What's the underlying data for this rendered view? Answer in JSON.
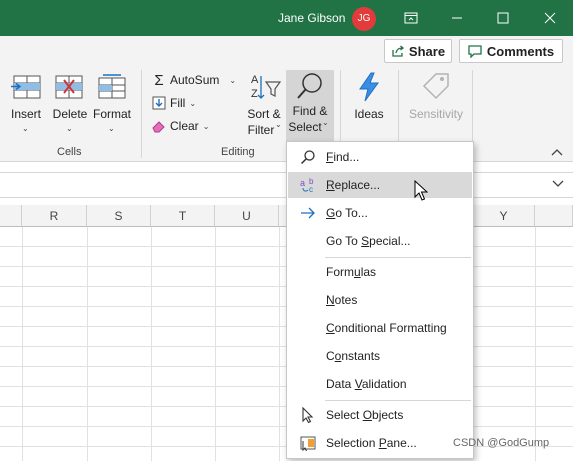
{
  "titlebar": {
    "user_name": "Jane Gibson",
    "avatar_initials": "JG",
    "bg_color": "#217346",
    "avatar_color": "#e23b3b"
  },
  "header_buttons": {
    "share": "Share",
    "comments": "Comments"
  },
  "ribbon": {
    "cells_group": {
      "label": "Cells",
      "insert": "Insert",
      "delete": "Delete",
      "format": "Format"
    },
    "editing_group": {
      "label": "Editing",
      "autosum": "AutoSum",
      "fill": "Fill",
      "clear": "Clear",
      "sort_filter_line1": "Sort &",
      "sort_filter_line2": "Filter",
      "find_select_line1": "Find &",
      "find_select_line2": "Select"
    },
    "ideas_group": {
      "ideas": "Ideas"
    },
    "sensitivity": "Sensitivity"
  },
  "columns": [
    "R",
    "S",
    "T",
    "U",
    "Y"
  ],
  "menu": {
    "items_group1": [
      {
        "key": "find",
        "pre": "",
        "u": "F",
        "post": "ind...",
        "icon": "search-icon"
      },
      {
        "key": "replace",
        "pre": "",
        "u": "R",
        "post": "eplace...",
        "icon": "replace-icon"
      },
      {
        "key": "goto",
        "pre": "",
        "u": "G",
        "post": "o To...",
        "icon": "arrow-right-icon"
      },
      {
        "key": "goto_special",
        "pre": "Go To ",
        "u": "S",
        "post": "pecial...",
        "icon": ""
      }
    ],
    "items_group2": [
      {
        "key": "formulas",
        "pre": "Form",
        "u": "u",
        "post": "las"
      },
      {
        "key": "notes",
        "pre": "",
        "u": "N",
        "post": "otes"
      },
      {
        "key": "conditional_formatting",
        "pre": "",
        "u": "C",
        "post": "onditional Formatting"
      },
      {
        "key": "constants",
        "pre": "C",
        "u": "o",
        "post": "nstants"
      },
      {
        "key": "data_validation",
        "pre": "Data ",
        "u": "V",
        "post": "alidation"
      }
    ],
    "items_group3": [
      {
        "key": "select_objects",
        "pre": "Select ",
        "u": "O",
        "post": "bjects",
        "icon": "pointer-icon"
      },
      {
        "key": "selection_pane",
        "pre": "Selection ",
        "u": "P",
        "post": "ane...",
        "icon": "selection-pane-icon"
      }
    ],
    "hovered_item": "replace"
  },
  "watermark": "CSDN @GodGump"
}
